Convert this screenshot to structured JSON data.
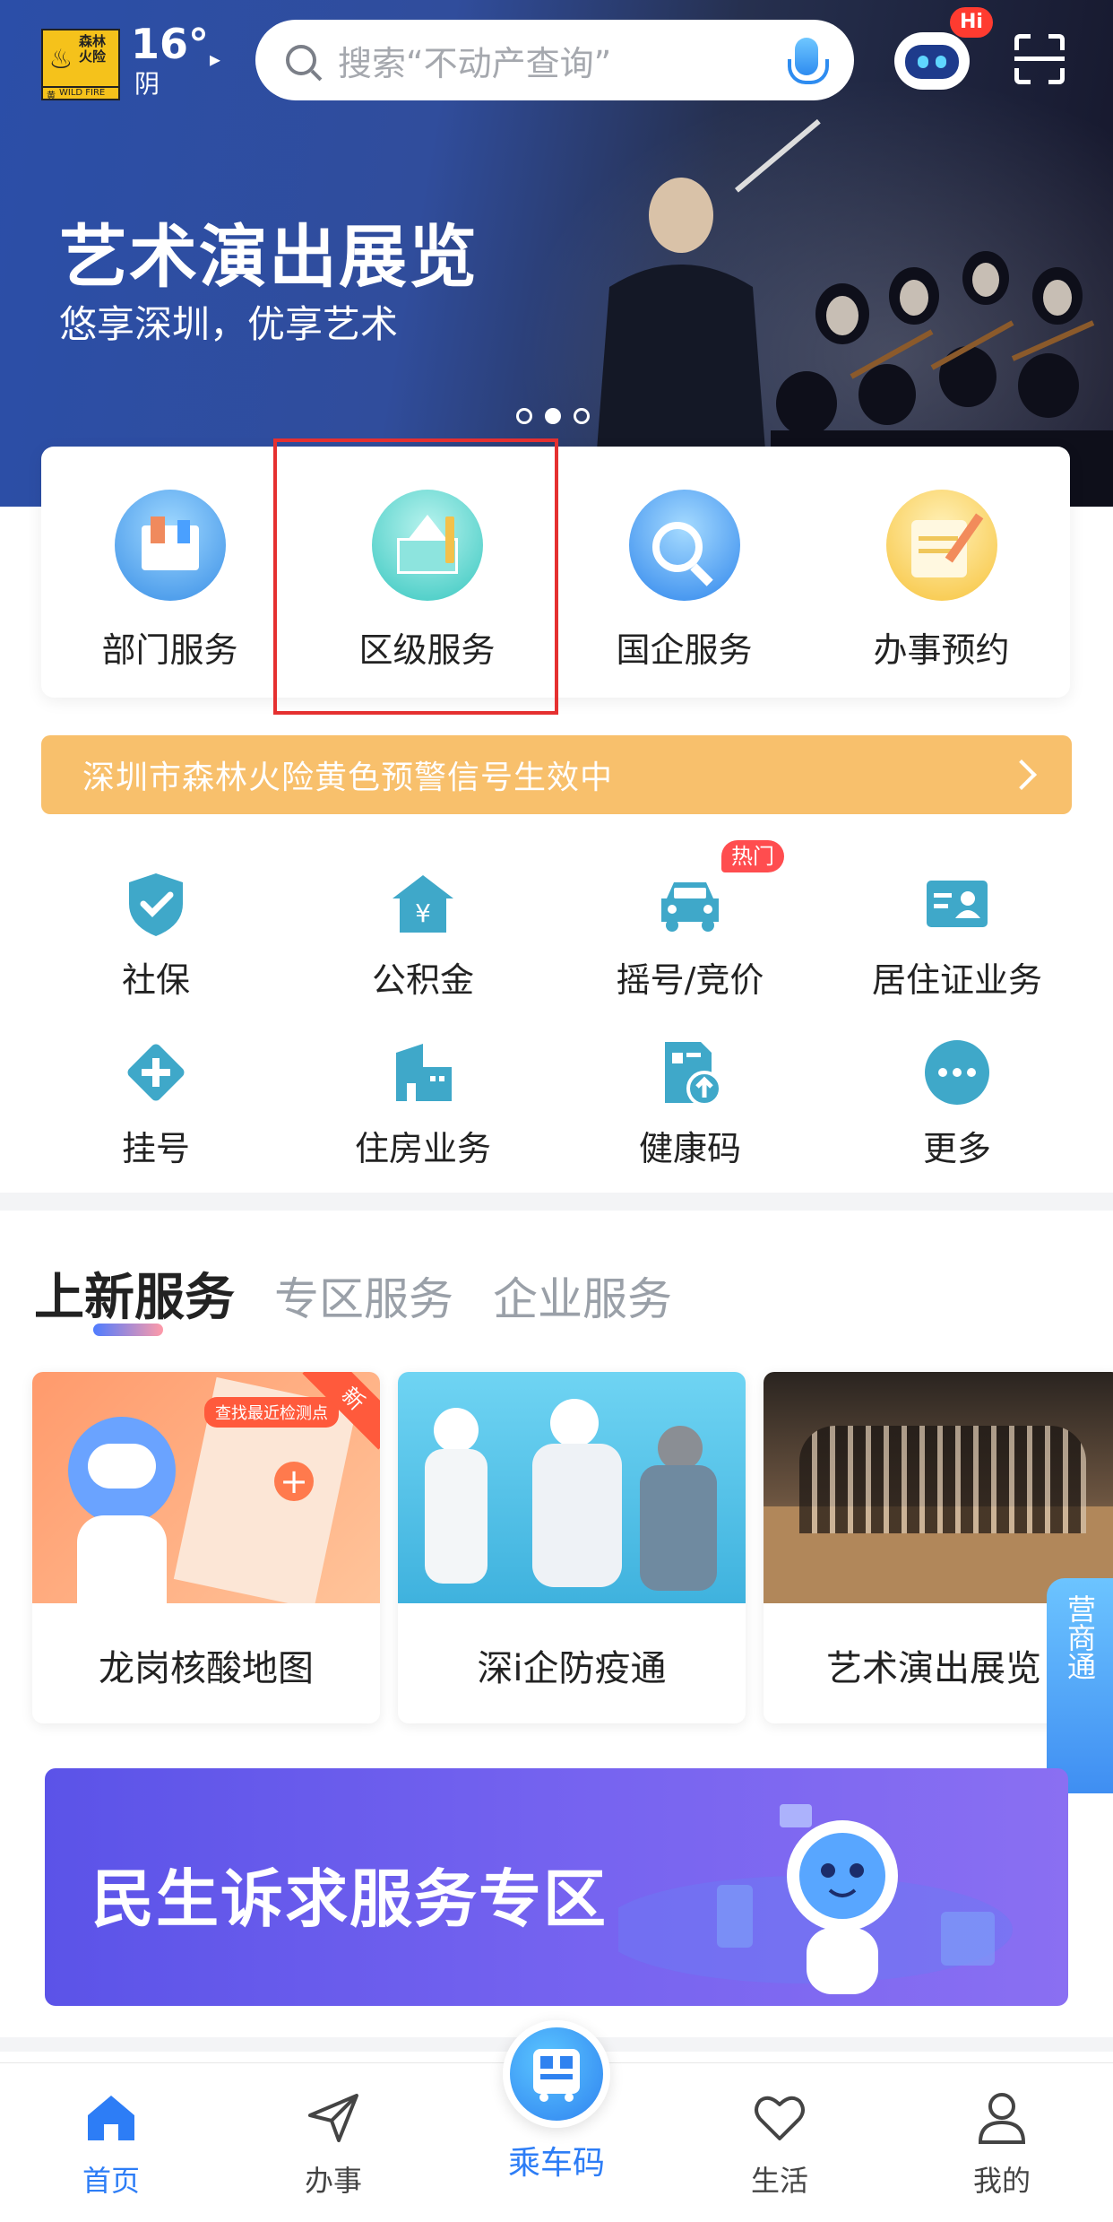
{
  "status": {
    "warning_badge_text": "森林火险",
    "warning_badge_level": "黄",
    "warning_badge_en": "WILD FIRE",
    "temperature": "16°",
    "weather": "阴"
  },
  "search": {
    "placeholder": "搜索“不动产查询”"
  },
  "assistant": {
    "badge": "Hi"
  },
  "hero": {
    "title": "艺术演出展览",
    "subtitle": "悠享深圳，优享艺术",
    "slide_count": 3,
    "active_slide": 2
  },
  "quick_services": [
    {
      "label": "部门服务",
      "icon": "department-icon"
    },
    {
      "label": "区级服务",
      "icon": "district-icon",
      "highlighted": true
    },
    {
      "label": "国企服务",
      "icon": "state-enterprise-icon"
    },
    {
      "label": "办事预约",
      "icon": "appointment-icon"
    }
  ],
  "alert": {
    "text": "深圳市森林火险黄色预警信号生效中"
  },
  "grid": [
    {
      "label": "社保",
      "icon": "shield-check-icon"
    },
    {
      "label": "公积金",
      "icon": "fund-house-icon"
    },
    {
      "label": "摇号/竞价",
      "icon": "car-icon",
      "badge": "热门"
    },
    {
      "label": "居住证业务",
      "icon": "id-card-icon"
    },
    {
      "label": "挂号",
      "icon": "medical-cross-icon"
    },
    {
      "label": "住房业务",
      "icon": "building-icon"
    },
    {
      "label": "健康码",
      "icon": "health-code-icon"
    },
    {
      "label": "更多",
      "icon": "more-icon"
    }
  ],
  "tabs": [
    {
      "label": "上新服务",
      "active": true
    },
    {
      "label": "专区服务",
      "active": false
    },
    {
      "label": "企业服务",
      "active": false
    }
  ],
  "cards": [
    {
      "label": "龙岗核酸地图",
      "tag": "新",
      "image_caption": "查找最近检测点"
    },
    {
      "label": "深i企防疫通"
    },
    {
      "label": "艺术演出展览"
    }
  ],
  "side_tab": {
    "text": "营商通"
  },
  "promo": {
    "title": "民生诉求服务专区"
  },
  "nav": {
    "items": [
      {
        "label": "首页",
        "icon": "home-icon",
        "active": true
      },
      {
        "label": "办事",
        "icon": "send-icon",
        "active": false
      },
      {
        "label": "乘车码",
        "icon": "bus-qr-icon",
        "active": false
      },
      {
        "label": "生活",
        "icon": "heart-icon",
        "active": false
      },
      {
        "label": "我的",
        "icon": "user-icon",
        "active": false
      }
    ]
  },
  "colors": {
    "accent": "#2d7df6",
    "alert_bg": "#f8c06c",
    "highlight_box": "#e53030",
    "promo_bg": "#6a5cf0",
    "hot_badge": "#ff4d4f"
  }
}
